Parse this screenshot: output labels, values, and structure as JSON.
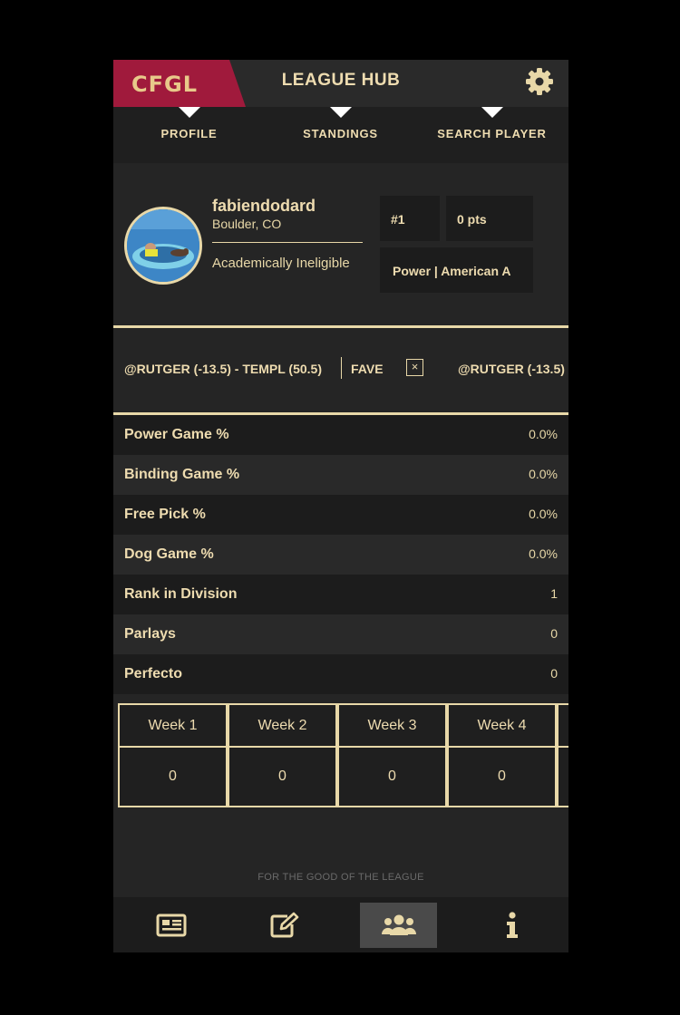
{
  "header": {
    "logo_text": "CFGL",
    "title": "LEAGUE HUB"
  },
  "tabs": [
    {
      "label": "PROFILE",
      "active": true
    },
    {
      "label": "STANDINGS",
      "active": false
    },
    {
      "label": "SEARCH PLAYER",
      "active": false
    }
  ],
  "profile": {
    "username": "fabiendodard",
    "location": "Boulder, CO",
    "status": "Academically Ineligible",
    "rank": "#1",
    "points": "0 pts",
    "division": "Power | American A"
  },
  "ticker": {
    "game": "@RUTGER (-13.5) - TEMPL (50.5)",
    "fave_label": "FAVE",
    "close_symbol": "×",
    "next_game": "@RUTGER (-13.5)"
  },
  "stats": [
    {
      "label": "Power Game %",
      "value": "0.0%"
    },
    {
      "label": "Binding Game %",
      "value": "0.0%"
    },
    {
      "label": "Free Pick %",
      "value": "0.0%"
    },
    {
      "label": "Dog Game %",
      "value": "0.0%"
    },
    {
      "label": "Rank in Division",
      "value": "1"
    },
    {
      "label": "Parlays",
      "value": "0"
    },
    {
      "label": "Perfecto",
      "value": "0"
    }
  ],
  "weeks": {
    "headers": [
      "Week 1",
      "Week 2",
      "Week 3",
      "Week 4"
    ],
    "values": [
      "0",
      "0",
      "0",
      "0"
    ]
  },
  "footer": "FOR THE GOOD OF THE LEAGUE",
  "bottom_nav": [
    {
      "icon": "newspaper-icon",
      "active": false
    },
    {
      "icon": "edit-icon",
      "active": false
    },
    {
      "icon": "users-icon",
      "active": true
    },
    {
      "icon": "info-icon",
      "active": false
    }
  ],
  "colors": {
    "accent": "#e8d8a8",
    "brand": "#a01a3c",
    "background": "#252525"
  }
}
